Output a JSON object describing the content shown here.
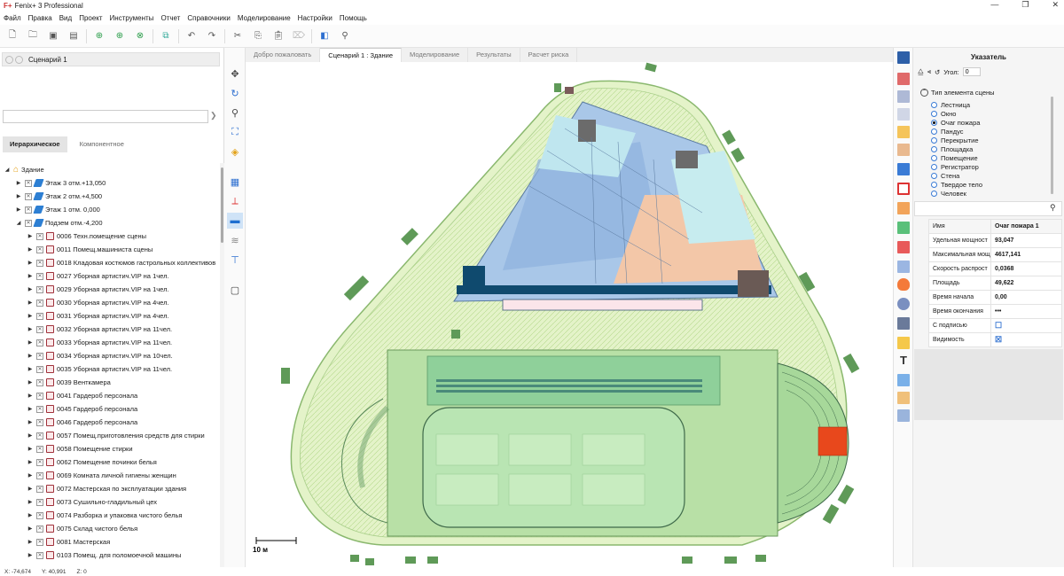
{
  "app": {
    "title": "Fenix+ 3 Professional",
    "logo": "F+",
    "window_buttons": [
      "—",
      "❐",
      "✕"
    ]
  },
  "menu": [
    "Файл",
    "Правка",
    "Вид",
    "Проект",
    "Инструменты",
    "Отчет",
    "Справочники",
    "Моделирование",
    "Настройки",
    "Помощь"
  ],
  "toolbar": {
    "icons": [
      "new-icon",
      "open-icon",
      "save-icon",
      "save-as-icon",
      "add-floor-icon",
      "add-scenario-icon",
      "copy-scenario-icon",
      "import-icon",
      "undo-icon",
      "redo-icon",
      "cut-icon",
      "copy-icon",
      "paste-icon",
      "delete-icon",
      "layers-3d-icon",
      "inspect-icon"
    ]
  },
  "left": {
    "scenario_label": "Сценарий 1",
    "search_value": "",
    "tree_tabs": [
      "Иерархическое",
      "Компонентное"
    ],
    "tree": [
      {
        "label": "Здание",
        "indent": 0,
        "icon": "house",
        "expanded": true,
        "check": false
      },
      {
        "label": "Этаж 3  отм.+13,050",
        "indent": 1,
        "icon": "layers",
        "expanded": false,
        "check": true
      },
      {
        "label": "Этаж 2  отм.+4,500",
        "indent": 1,
        "icon": "layers",
        "expanded": false,
        "check": true
      },
      {
        "label": "Этаж 1   отм.  0,000",
        "indent": 1,
        "icon": "layers",
        "expanded": false,
        "check": true
      },
      {
        "label": "Подзем отм.-4,200",
        "indent": 1,
        "icon": "layers",
        "expanded": true,
        "check": true
      },
      {
        "label": "0006 Техн.помещение сцены",
        "indent": 2,
        "icon": "room",
        "expanded": false,
        "check": true
      },
      {
        "label": "0011 Помещ.машиниста сцены",
        "indent": 2,
        "icon": "room",
        "expanded": false,
        "check": true
      },
      {
        "label": "0018 Кладовая костюмов гастрольных коллективов",
        "indent": 2,
        "icon": "room",
        "expanded": false,
        "check": true
      },
      {
        "label": "0027 Уборная артистич.VIP на 1чел.",
        "indent": 2,
        "icon": "room",
        "expanded": false,
        "check": true
      },
      {
        "label": "0029 Уборная артистич.VIP на 1чел.",
        "indent": 2,
        "icon": "room",
        "expanded": false,
        "check": true
      },
      {
        "label": "0030 Уборная артистич.VIP на 4чел.",
        "indent": 2,
        "icon": "room",
        "expanded": false,
        "check": true
      },
      {
        "label": "0031 Уборная артистич.VIP на 4чел.",
        "indent": 2,
        "icon": "room",
        "expanded": false,
        "check": true
      },
      {
        "label": "0032 Уборная артистич.VIP на 11чел.",
        "indent": 2,
        "icon": "room",
        "expanded": false,
        "check": true
      },
      {
        "label": "0033 Уборная артистич.VIP на 11чел.",
        "indent": 2,
        "icon": "room",
        "expanded": false,
        "check": true
      },
      {
        "label": "0034 Уборная артистич.VIP на 10чел.",
        "indent": 2,
        "icon": "room",
        "expanded": false,
        "check": true
      },
      {
        "label": "0035 Уборная артистич.VIP на 11чел.",
        "indent": 2,
        "icon": "room",
        "expanded": false,
        "check": true
      },
      {
        "label": "0039 Венткамера",
        "indent": 2,
        "icon": "room",
        "expanded": false,
        "check": true
      },
      {
        "label": "0041 Гардероб персонала",
        "indent": 2,
        "icon": "room",
        "expanded": false,
        "check": true
      },
      {
        "label": "0045 Гардероб персонала",
        "indent": 2,
        "icon": "room",
        "expanded": false,
        "check": true
      },
      {
        "label": "0046 Гардероб персонала",
        "indent": 2,
        "icon": "room",
        "expanded": false,
        "check": true
      },
      {
        "label": "0057 Помещ.приготовления средств для стирки",
        "indent": 2,
        "icon": "room",
        "expanded": false,
        "check": true
      },
      {
        "label": "0058 Помещение стирки",
        "indent": 2,
        "icon": "room",
        "expanded": false,
        "check": true
      },
      {
        "label": "0062 Помещение починки белья",
        "indent": 2,
        "icon": "room",
        "expanded": false,
        "check": true
      },
      {
        "label": "0069 Комната личной гигиены женщин",
        "indent": 2,
        "icon": "room",
        "expanded": false,
        "check": true
      },
      {
        "label": "0072 Мастерская по эксплуатации здания",
        "indent": 2,
        "icon": "room",
        "expanded": false,
        "check": true
      },
      {
        "label": "0073 Сушильно-гладильный цех",
        "indent": 2,
        "icon": "room",
        "expanded": false,
        "check": true
      },
      {
        "label": "0074 Разборка и упаковка чистого белья",
        "indent": 2,
        "icon": "room",
        "expanded": false,
        "check": true
      },
      {
        "label": "0075 Склад чистого белья",
        "indent": 2,
        "icon": "room",
        "expanded": false,
        "check": true
      },
      {
        "label": "0081 Мастерская",
        "indent": 2,
        "icon": "room",
        "expanded": false,
        "check": true
      },
      {
        "label": "0103 Помещ. для поломоечной машины",
        "indent": 2,
        "icon": "room",
        "expanded": false,
        "check": true
      }
    ]
  },
  "tabs": [
    "Добро пожаловать",
    "Сценарий 1 : Здание",
    "Моделирование",
    "Результаты",
    "Расчет риска"
  ],
  "active_tab": 1,
  "canvas": {
    "scale_label": "10 м"
  },
  "right": {
    "title": "Указатель",
    "angle_label": "Угол:",
    "angle_value": "0",
    "type_header": "Тип элемента сцены",
    "types": [
      "Лестница",
      "Окно",
      "Очаг пожара",
      "Пандус",
      "Перекрытие",
      "Площадка",
      "Помещение",
      "Регистратор",
      "Стена",
      "Твердое тело",
      "Человек"
    ],
    "selected_type": "Очаг пожара",
    "props_header": {
      "key": "Имя",
      "value": "Очаг пожара 1"
    },
    "props": [
      {
        "key": "Удельная мощност",
        "value": "93,047"
      },
      {
        "key": "Максимальная мощ",
        "value": "4617,141"
      },
      {
        "key": "Скорость распрост",
        "value": "0,0368"
      },
      {
        "key": "Площадь",
        "value": "49,622"
      },
      {
        "key": "Время начала",
        "value": "0,00"
      },
      {
        "key": "Время окончания",
        "value": "•••"
      },
      {
        "key": "С подписью",
        "value": "☐"
      },
      {
        "key": "Видимость",
        "value": "☒"
      }
    ]
  },
  "status": {
    "x": "X:  -74,674",
    "y": "Y:  40,991",
    "z": "Z:  0"
  }
}
